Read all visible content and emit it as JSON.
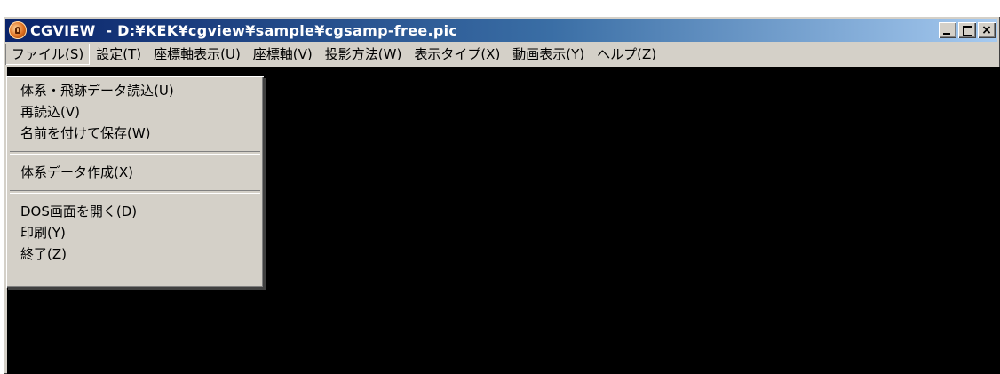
{
  "window": {
    "title": "CGVIEW  - D:¥KEK¥cgview¥sample¥cgsamp-free.pic",
    "icon": "cgview-app-icon",
    "caption_buttons": {
      "minimize": "minimize-icon",
      "maximize": "maximize-icon",
      "close_label": "×"
    }
  },
  "menubar": {
    "items": [
      {
        "label": "ファイル(S)"
      },
      {
        "label": "設定(T)"
      },
      {
        "label": "座標軸表示(U)"
      },
      {
        "label": "座標軸(V)"
      },
      {
        "label": "投影方法(W)"
      },
      {
        "label": "表示タイプ(X)"
      },
      {
        "label": "動画表示(Y)"
      },
      {
        "label": "ヘルプ(Z)"
      }
    ],
    "active_index": 0
  },
  "file_menu": {
    "group1": [
      {
        "label": "体系・飛跡データ読込(U)"
      },
      {
        "label": "再読込(V)"
      },
      {
        "label": "名前を付けて保存(W)"
      }
    ],
    "group2": [
      {
        "label": "体系データ作成(X)"
      }
    ],
    "group3": [
      {
        "label": "DOS画面を開く(D)"
      },
      {
        "label": "印刷(Y)"
      },
      {
        "label": "終了(Z)"
      }
    ]
  },
  "colors": {
    "title_gradient_start": "#0a246a",
    "title_gradient_end": "#a6caf0",
    "client_background": "#000000",
    "chrome": "#d4d0c8"
  }
}
